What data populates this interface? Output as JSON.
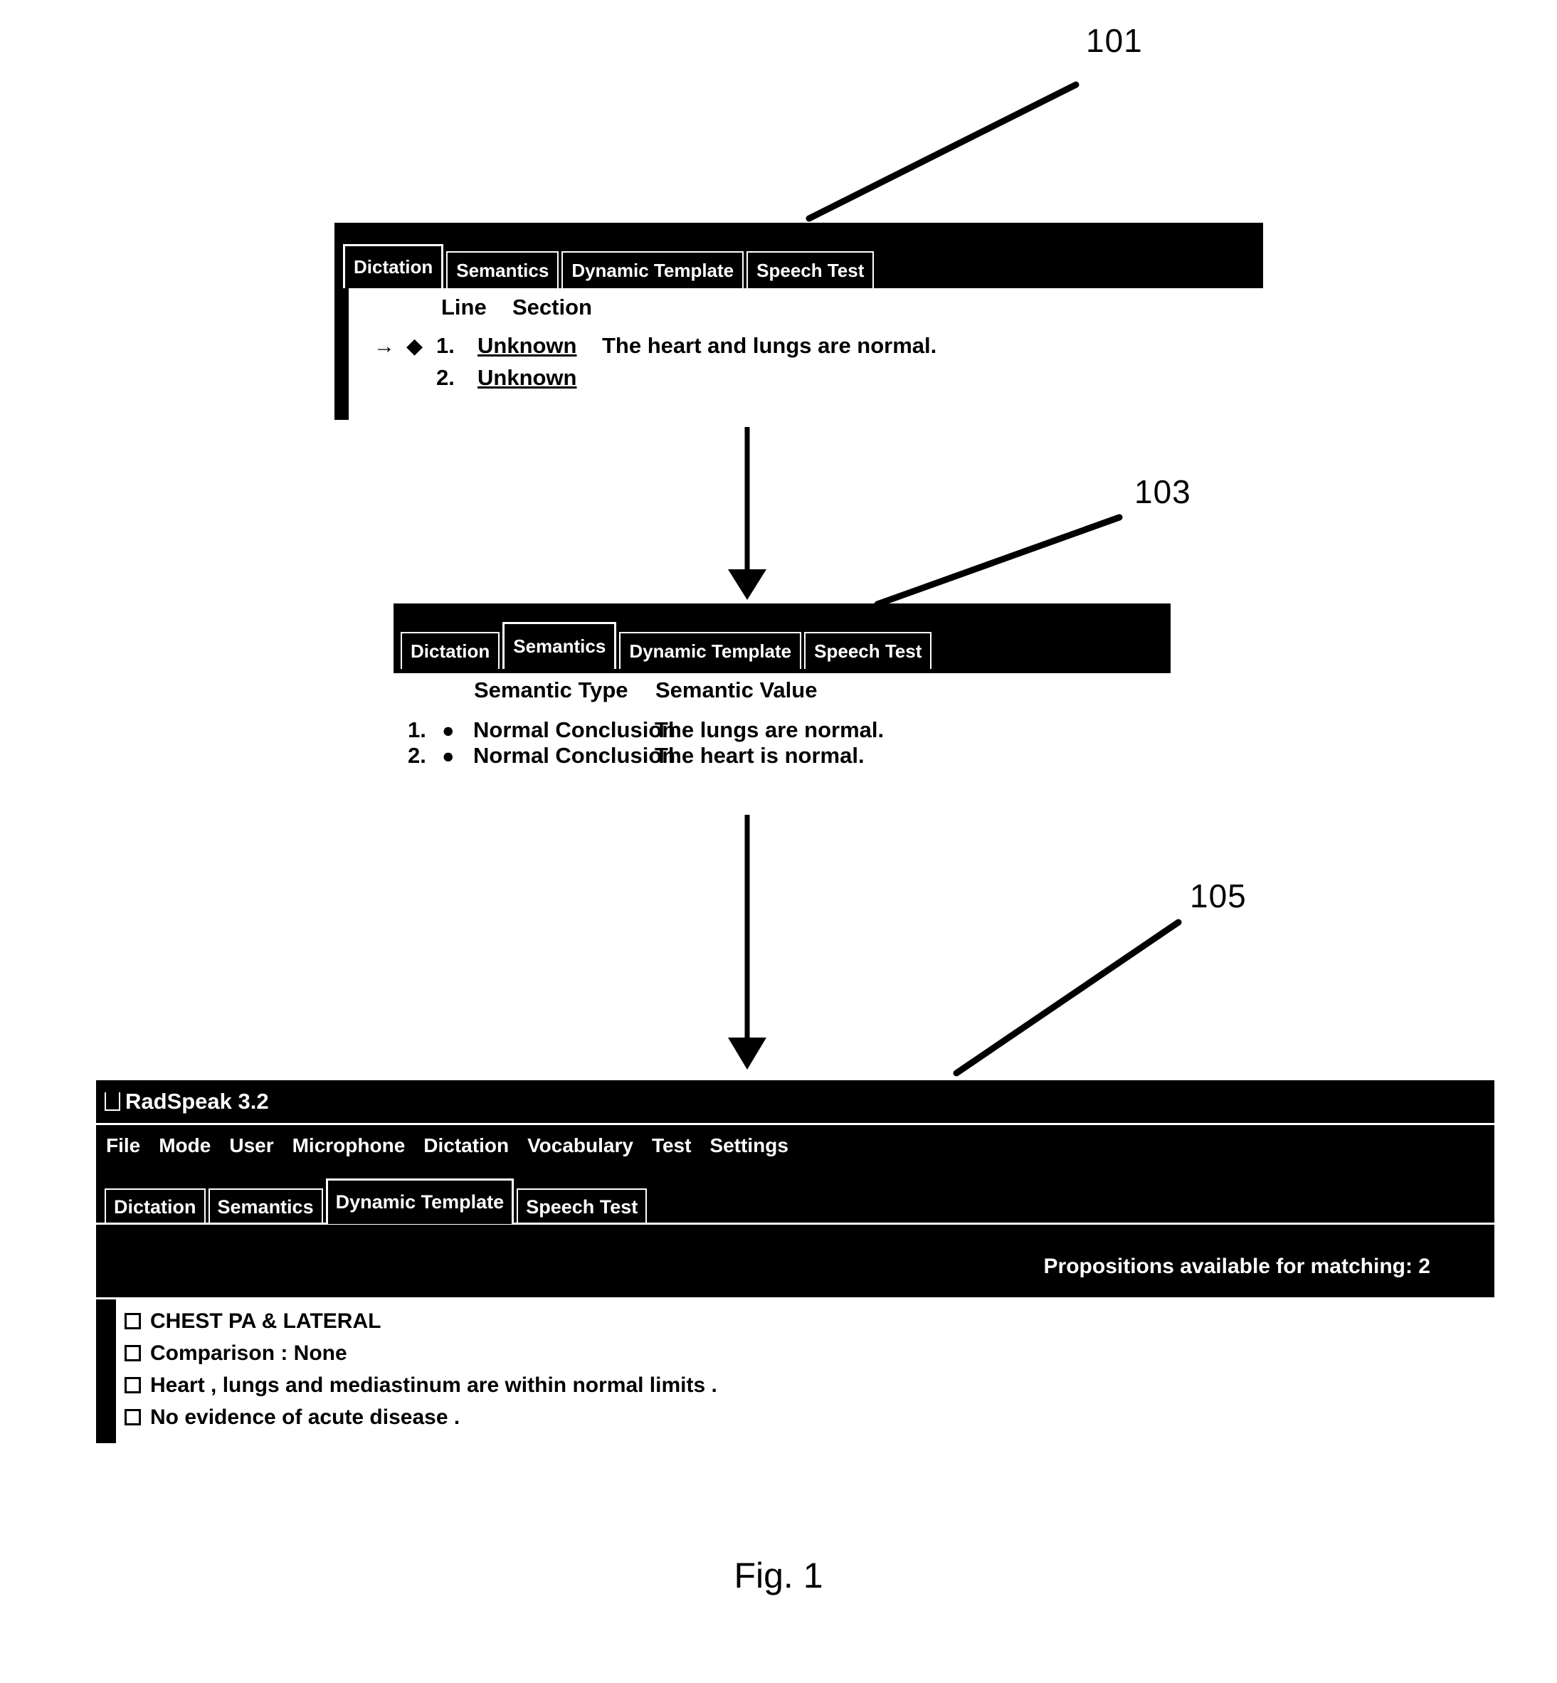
{
  "figure": {
    "caption": "Fig. 1",
    "reference_numerals": [
      {
        "id": "101",
        "label": "101"
      },
      {
        "id": "103",
        "label": "103"
      },
      {
        "id": "105",
        "label": "105"
      }
    ]
  },
  "panel_101": {
    "reference": "101",
    "tabs": [
      {
        "label": "Dictation",
        "selected": true
      },
      {
        "label": "Semantics",
        "selected": false
      },
      {
        "label": "Dynamic Template",
        "selected": false
      },
      {
        "label": "Speech Test",
        "selected": false
      }
    ],
    "columns": {
      "line": "Line",
      "section": "Section"
    },
    "rows": [
      {
        "cursor": "→",
        "bullet": "◆",
        "line": "1.",
        "section": "Unknown",
        "utterance": "The heart and lungs are normal."
      },
      {
        "cursor": "",
        "bullet": "",
        "line": "2.",
        "section": "Unknown",
        "utterance": ""
      }
    ]
  },
  "panel_103": {
    "reference": "103",
    "tabs": [
      {
        "label": "Dictation",
        "selected": false
      },
      {
        "label": "Semantics",
        "selected": true
      },
      {
        "label": "Dynamic Template",
        "selected": false
      },
      {
        "label": "Speech Test",
        "selected": false
      }
    ],
    "columns": {
      "semantic_type": "Semantic Type",
      "semantic_value": "Semantic Value"
    },
    "rows": [
      {
        "index": "1.",
        "bullet": "●",
        "semantic_type": "Normal Conclusion",
        "semantic_value": "The lungs are normal."
      },
      {
        "index": "2.",
        "bullet": "●",
        "semantic_type": "Normal Conclusion",
        "semantic_value": "The heart is normal."
      }
    ]
  },
  "panel_105": {
    "reference": "105",
    "window_title": "RadSpeak 3.2",
    "app_icon": "app-window-icon",
    "menu_items": [
      "File",
      "Mode",
      "User",
      "Microphone",
      "Dictation",
      "Vocabulary",
      "Test",
      "Settings"
    ],
    "tabs": [
      {
        "label": "Dictation",
        "selected": false
      },
      {
        "label": "Semantics",
        "selected": false
      },
      {
        "label": "Dynamic Template",
        "selected": true
      },
      {
        "label": "Speech Test",
        "selected": false
      }
    ],
    "status": "Propositions available for matching: 2",
    "propositions": [
      {
        "checked": false,
        "text": "CHEST PA & LATERAL"
      },
      {
        "checked": false,
        "text": "Comparison : None"
      },
      {
        "checked": false,
        "text": "Heart , lungs and mediastinum are within normal limits ."
      },
      {
        "checked": false,
        "text": "No evidence of acute disease ."
      }
    ]
  },
  "colors": {
    "background": "#ffffff",
    "window_chrome": "#000000",
    "chrome_text": "#ffffff",
    "body_text": "#000000"
  }
}
